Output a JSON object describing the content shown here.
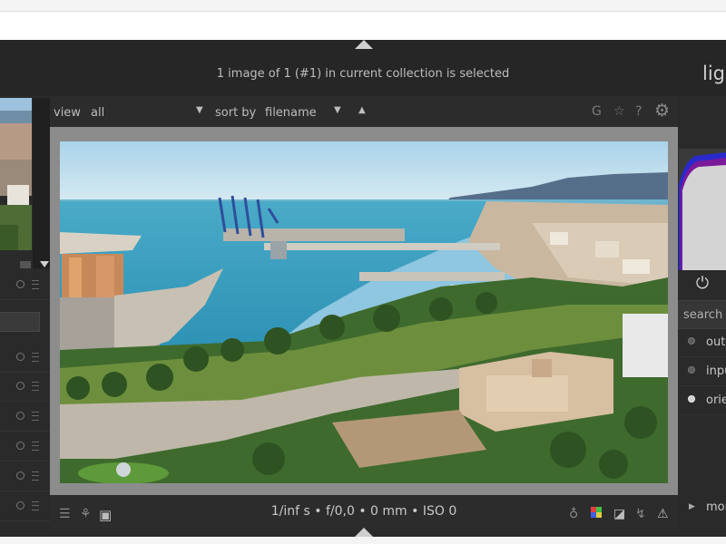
{
  "header": {
    "selection_status": "1 image of 1 (#1) in current collection is selected",
    "module_title": "ligh"
  },
  "filter_bar": {
    "view_label": "view",
    "view_value": "all",
    "sort_label": "sort by",
    "sort_value": "filename",
    "sort_order_icon": "up-triangle-icon",
    "right_icons": [
      "grouping-icon",
      "star-icon",
      "help-icon",
      "gear-icon"
    ],
    "grouping_glyph": "G",
    "star_glyph": "☆",
    "help_glyph": "?",
    "gear_glyph": "⚙"
  },
  "bottom_bar": {
    "exif": "1/inf s • f/0,0 • 0 mm • ISO 0",
    "left_icons": [
      "menu-icon",
      "presets-icon",
      "display-icon"
    ],
    "right_icons": [
      "bulb-icon",
      "color-picker-icon",
      "overexposed-icon",
      "softproof-icon",
      "gamut-check-icon"
    ]
  },
  "right_panel": {
    "search_placeholder": "search r",
    "modules": [
      {
        "label": "outp",
        "enabled": false
      },
      {
        "label": "inpu",
        "enabled": false
      },
      {
        "label": "orie",
        "enabled": true
      }
    ],
    "more_modules": "mor"
  },
  "colors": {
    "background": "#2a2a2a",
    "text": "#bdbdbd",
    "image_frame": "#8c8c8c"
  }
}
